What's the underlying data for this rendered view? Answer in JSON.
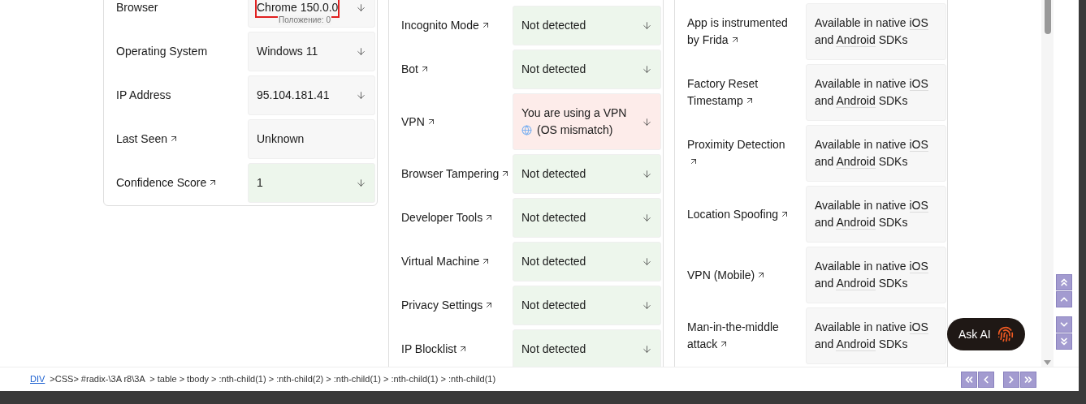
{
  "identification": {
    "rows": [
      {
        "label": "Browser",
        "link": false,
        "value": "Chrome 150.0.0",
        "color": "#f7f7f7",
        "expandable": true,
        "highlighted": true,
        "inspector_tooltip": "Положение: 0"
      },
      {
        "label": "Operating System",
        "link": false,
        "value": "Windows 11",
        "color": "#f7f7f7",
        "expandable": true,
        "highlighted": false
      },
      {
        "label": "IP Address",
        "link": false,
        "value": "95.104.181.41",
        "color": "#f7f7f7",
        "expandable": true,
        "highlighted": false
      },
      {
        "label": "Last Seen",
        "link": true,
        "value": "Unknown",
        "color": "#f7f7f7",
        "expandable": false,
        "highlighted": false
      },
      {
        "label": "Confidence Score",
        "link": true,
        "value": "1",
        "color": "#edf6ec",
        "expandable": true,
        "highlighted": false
      }
    ]
  },
  "smart_signals": {
    "rows": [
      {
        "label": "Incognito Mode",
        "link": true,
        "value": "Not detected",
        "color": "#edf6ec",
        "expandable": true
      },
      {
        "label": "Bot",
        "link": true,
        "value": "Not detected",
        "color": "#edf6ec",
        "expandable": true
      },
      {
        "label": "VPN",
        "link": true,
        "value": "You are using a VPN",
        "note": "(OS mismatch)",
        "color": "#fdecea",
        "expandable": true
      },
      {
        "label": "Browser Tampering",
        "link": true,
        "value": "Not detected",
        "color": "#edf6ec",
        "expandable": true
      },
      {
        "label": "Developer Tools",
        "link": true,
        "value": "Not detected",
        "color": "#edf6ec",
        "expandable": true
      },
      {
        "label": "Virtual Machine",
        "link": true,
        "value": "Not detected",
        "color": "#edf6ec",
        "expandable": true
      },
      {
        "label": "Privacy Settings",
        "link": true,
        "value": "Not detected",
        "color": "#edf6ec",
        "expandable": true
      },
      {
        "label": "IP Blocklist",
        "link": true,
        "value": "Not detected",
        "color": "#edf6ec",
        "expandable": true
      }
    ]
  },
  "mobile_signals": {
    "rows": [
      {
        "label": "App is instrumented by Frida",
        "link": true,
        "color": "#f7f7f7",
        "value_parts": [
          {
            "kind": "text",
            "text": "Available in native"
          },
          {
            "kind": "link",
            "text": "iOS"
          },
          {
            "kind": "text",
            "text": "and"
          },
          {
            "kind": "link",
            "text": "Android"
          },
          {
            "kind": "text",
            "text": "SDKs"
          }
        ]
      },
      {
        "label": "Factory Reset Timestamp",
        "link": true,
        "color": "#f7f7f7",
        "value_parts": [
          {
            "kind": "text",
            "text": "Available in native"
          },
          {
            "kind": "link",
            "text": "iOS"
          },
          {
            "kind": "text",
            "text": "and"
          },
          {
            "kind": "link",
            "text": "Android"
          },
          {
            "kind": "text",
            "text": "SDKs"
          }
        ]
      },
      {
        "label": "Proximity Detection",
        "link": true,
        "color": "#f7f7f7",
        "value_parts": [
          {
            "kind": "text",
            "text": "Available in native"
          },
          {
            "kind": "link",
            "text": "iOS"
          },
          {
            "kind": "text",
            "text": "and"
          },
          {
            "kind": "link",
            "text": "Android"
          },
          {
            "kind": "text",
            "text": "SDKs"
          }
        ]
      },
      {
        "label": "Location Spoofing",
        "link": true,
        "color": "#f7f7f7",
        "value_parts": [
          {
            "kind": "text",
            "text": "Available in native"
          },
          {
            "kind": "link",
            "text": "iOS"
          },
          {
            "kind": "text",
            "text": "and"
          },
          {
            "kind": "link",
            "text": "Android"
          },
          {
            "kind": "text",
            "text": "SDKs"
          }
        ]
      },
      {
        "label": "VPN (Mobile)",
        "link": true,
        "color": "#f7f7f7",
        "value_parts": [
          {
            "kind": "text",
            "text": "Available in native"
          },
          {
            "kind": "link",
            "text": "iOS"
          },
          {
            "kind": "text",
            "text": "and"
          },
          {
            "kind": "link",
            "text": "Android"
          },
          {
            "kind": "text",
            "text": "SDKs"
          }
        ]
      },
      {
        "label": "Man-in-the-middle attack",
        "link": true,
        "color": "#f7f7f7",
        "value_parts": [
          {
            "kind": "text",
            "text": "Available in native"
          },
          {
            "kind": "link",
            "text": "iOS"
          },
          {
            "kind": "text",
            "text": "and"
          },
          {
            "kind": "link",
            "text": "Android"
          },
          {
            "kind": "text",
            "text": "SDKs"
          }
        ]
      }
    ]
  },
  "ask_ai_button": {
    "label": "Ask AI"
  },
  "breadcrumb": {
    "element": "DIV",
    "selector": ">CSS> #radix-\\3A r8\\3A  > table > tbody > :nth-child(1) > :nth-child(2) > :nth-child(1) > :nth-child(1) > :nth-child(1)"
  }
}
